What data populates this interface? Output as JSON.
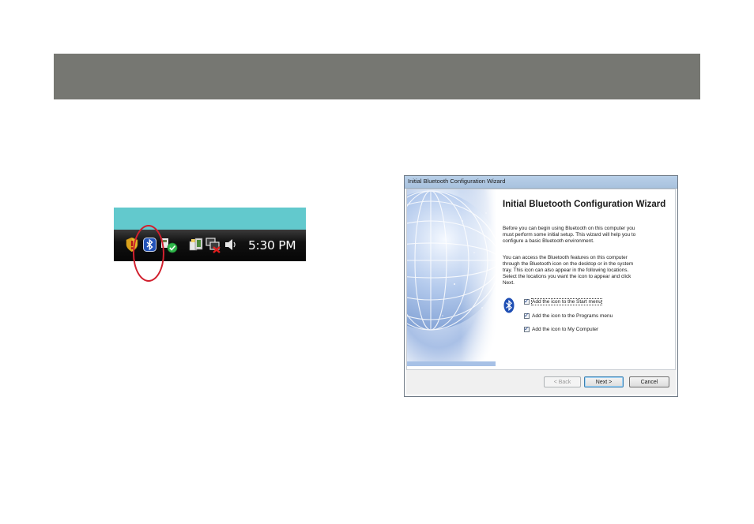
{
  "header": {
    "color": "#767772"
  },
  "taskbar": {
    "clock": "5:30 PM",
    "desktop_color": "#62c9cd",
    "tray_icons": [
      "shield-warning-icon",
      "bluetooth-icon",
      "security-center-check-icon",
      "safely-remove-hardware-icon",
      "network-disconnected-icon",
      "volume-icon"
    ],
    "highlight_color": "#d1202e"
  },
  "wizard": {
    "window_title": "Initial Bluetooth Configuration Wizard",
    "heading": "Initial Bluetooth Configuration Wizard",
    "intro_lines": [
      "Before you can begin using Bluetooth on this computer you",
      "must perform some initial setup. This wizard will help you to",
      "configure a basic Bluetooth environment."
    ],
    "locations_lines": [
      "You can access the Bluetooth features on this computer",
      "through the Bluetooth icon on the desktop or in the system",
      "tray. This icon can also appear in the following locations.",
      "Select the locations you want the icon to appear and click",
      "Next."
    ],
    "options": [
      {
        "label": "Add the icon to the Start menu",
        "checked": true
      },
      {
        "label": "Add the icon to the Programs menu",
        "checked": true
      },
      {
        "label": "Add the icon to My Computer",
        "checked": true
      }
    ],
    "buttons": {
      "back": "< Back",
      "next": "Next >",
      "cancel": "Cancel"
    }
  }
}
